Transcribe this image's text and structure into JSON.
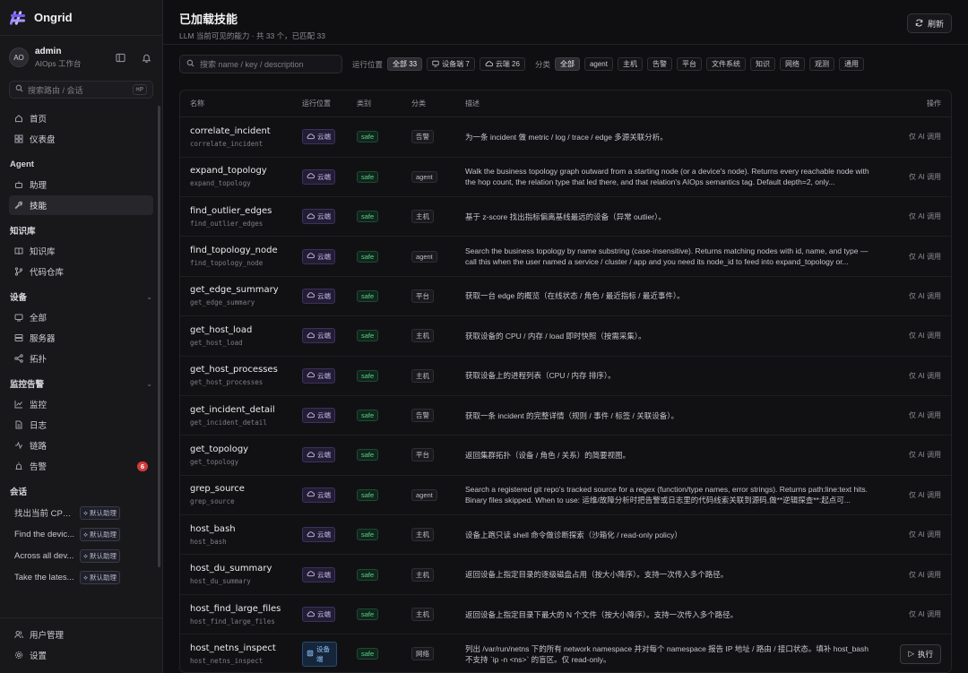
{
  "app": {
    "name": "Ongrid"
  },
  "user": {
    "initials": "AO",
    "name": "admin",
    "role": "AIOps 工作台"
  },
  "sidebar": {
    "search_placeholder": "搜索路由 / 会话",
    "search_shortcut": "⌘P",
    "top_items": [
      {
        "label": "首页",
        "icon": "home-icon"
      },
      {
        "label": "仪表盘",
        "icon": "dashboard-icon"
      }
    ],
    "sections": {
      "agent": {
        "title": "Agent",
        "items": [
          {
            "label": "助理"
          },
          {
            "label": "技能"
          }
        ]
      },
      "kb": {
        "title": "知识库",
        "items": [
          {
            "label": "知识库"
          },
          {
            "label": "代码仓库"
          }
        ]
      },
      "devices": {
        "title": "设备",
        "items": [
          {
            "label": "全部"
          },
          {
            "label": "服务器"
          },
          {
            "label": "拓扑"
          }
        ]
      },
      "monitor": {
        "title": "监控告警",
        "items": [
          {
            "label": "监控"
          },
          {
            "label": "日志"
          },
          {
            "label": "链路"
          },
          {
            "label": "告警",
            "badge": "6"
          }
        ]
      },
      "conversations": {
        "title": "会话",
        "items": [
          {
            "text": "找出当前 CPU...",
            "tag": "默认助理"
          },
          {
            "text": "Find the devic...",
            "tag": "默认助理"
          },
          {
            "text": "Across all dev...",
            "tag": "默认助理"
          },
          {
            "text": "Take the lates...",
            "tag": "默认助理"
          }
        ]
      }
    },
    "bottom_items": [
      {
        "label": "用户管理"
      },
      {
        "label": "设置"
      }
    ]
  },
  "header": {
    "title": "已加载技能",
    "subtitle": "LLM 当前可见的能力 · 共 33 个，已匹配 33",
    "refresh_label": "刷新"
  },
  "filters": {
    "search_placeholder": "搜索 name / key / description",
    "location_label": "运行位置",
    "location_chips": [
      "全部 33",
      "设备端 7",
      "云端 26"
    ],
    "category_label": "分类",
    "category_chips": [
      "全部",
      "agent",
      "主机",
      "告警",
      "平台",
      "文件系统",
      "知识",
      "网络",
      "观测",
      "通用"
    ]
  },
  "table": {
    "columns": {
      "name": "名称",
      "location": "运行位置",
      "class": "类别",
      "category": "分类",
      "description": "描述",
      "actions": "操作"
    },
    "rows": [
      {
        "name": "correlate_incident",
        "key": "correlate_incident",
        "location": "云端",
        "class": "safe",
        "category": "告警",
        "description": "为一条 incident 做 metric / log / trace / edge 多源关联分析。",
        "action": "仅 AI 调用"
      },
      {
        "name": "expand_topology",
        "key": "expand_topology",
        "location": "云端",
        "class": "safe",
        "category": "agent",
        "description": "Walk the business topology graph outward from a starting node (or a device's node). Returns every reachable node with the hop count, the relation type that led there, and that relation's AIOps semantics tag. Default depth=2, only...",
        "action": "仅 AI 调用"
      },
      {
        "name": "find_outlier_edges",
        "key": "find_outlier_edges",
        "location": "云端",
        "class": "safe",
        "category": "主机",
        "description": "基于 z-score 找出指标偏离基线最远的设备（异常 outlier）。",
        "action": "仅 AI 调用"
      },
      {
        "name": "find_topology_node",
        "key": "find_topology_node",
        "location": "云端",
        "class": "safe",
        "category": "agent",
        "description": "Search the business topology by name substring (case-insensitive). Returns matching nodes with id, name, and type — call this when the user named a service / cluster / app and you need its node_id to feed into expand_topology or...",
        "action": "仅 AI 调用"
      },
      {
        "name": "get_edge_summary",
        "key": "get_edge_summary",
        "location": "云端",
        "class": "safe",
        "category": "平台",
        "description": "获取一台 edge 的概览（在线状态 / 角色 / 最近指标 / 最近事件）。",
        "action": "仅 AI 调用"
      },
      {
        "name": "get_host_load",
        "key": "get_host_load",
        "location": "云端",
        "class": "safe",
        "category": "主机",
        "description": "获取设备的 CPU / 内存 / load 即时快照（按需采集）。",
        "action": "仅 AI 调用"
      },
      {
        "name": "get_host_processes",
        "key": "get_host_processes",
        "location": "云端",
        "class": "safe",
        "category": "主机",
        "description": "获取设备上的进程列表（CPU / 内存 排序）。",
        "action": "仅 AI 调用"
      },
      {
        "name": "get_incident_detail",
        "key": "get_incident_detail",
        "location": "云端",
        "class": "safe",
        "category": "告警",
        "description": "获取一条 incident 的完整详情（规则 / 事件 / 标签 / 关联设备）。",
        "action": "仅 AI 调用"
      },
      {
        "name": "get_topology",
        "key": "get_topology",
        "location": "云端",
        "class": "safe",
        "category": "平台",
        "description": "返回集群拓扑（设备 / 角色 / 关系）的简要视图。",
        "action": "仅 AI 调用"
      },
      {
        "name": "grep_source",
        "key": "grep_source",
        "location": "云端",
        "class": "safe",
        "category": "agent",
        "description": "Search a registered git repo's tracked source for a regex (function/type names, error strings). Returns path:line:text hits. Binary files skipped. When to use: 运维/故障分析时把告警或日志里的代码线索关联到源码,做**逆辑探查**:起点可...",
        "action": "仅 AI 调用"
      },
      {
        "name": "host_bash",
        "key": "host_bash",
        "location": "云端",
        "class": "safe",
        "category": "主机",
        "description": "设备上跑只读 shell 命令做诊断探索（沙箱化 / read-only policy）",
        "action": "仅 AI 调用"
      },
      {
        "name": "host_du_summary",
        "key": "host_du_summary",
        "location": "云端",
        "class": "safe",
        "category": "主机",
        "description": "返回设备上指定目录的逐级磁盘占用（按大小降序）。支持一次传入多个路径。",
        "action": "仅 AI 调用"
      },
      {
        "name": "host_find_large_files",
        "key": "host_find_large_files",
        "location": "云端",
        "class": "safe",
        "category": "主机",
        "description": "返回设备上指定目录下最大的 N 个文件（按大小降序）。支持一次传入多个路径。",
        "action": "仅 AI 调用"
      },
      {
        "name": "host_netns_inspect",
        "key": "host_netns_inspect",
        "location": "设备端",
        "class": "safe",
        "category": "网络",
        "description": "列出 /var/run/netns 下的所有 network namespace 并对每个 namespace 报告 IP 地址 / 路由 / 接口状态。填补 host_bash 不支持 `ip -n <ns>` 的盲区。仅 read-only。",
        "action": "执行",
        "action_type": "button"
      }
    ]
  }
}
